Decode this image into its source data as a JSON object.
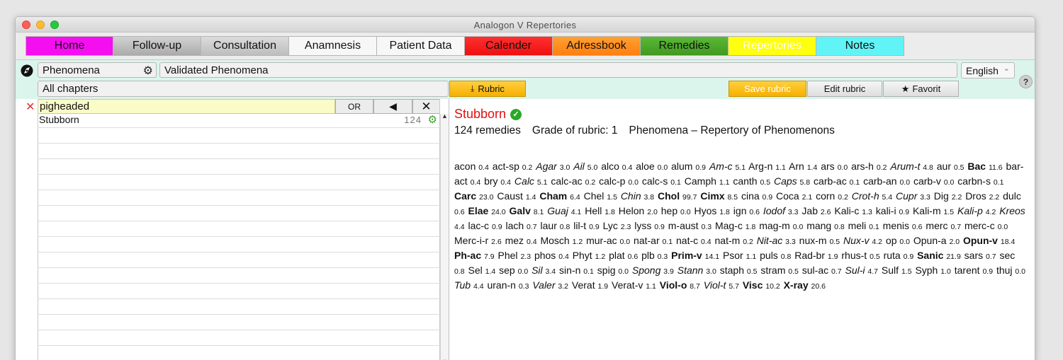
{
  "window": {
    "title": "Analogon  V  Repertories"
  },
  "tabs": [
    {
      "label": "Home",
      "color": "#f40ef0"
    },
    {
      "label": "Follow-up",
      "color": "#b5b5b5"
    },
    {
      "label": "Consultation",
      "color": "#c5c5c5"
    },
    {
      "label": "Anamnesis",
      "color": "#f5f5f5"
    },
    {
      "label": "Patient Data",
      "color": "#f5f5f5"
    },
    {
      "label": "Calender",
      "color": "#ff2020"
    },
    {
      "label": "Adressbook",
      "color": "#ff8a1a"
    },
    {
      "label": "Remedies",
      "color": "#4ea829"
    },
    {
      "label": "Repertories",
      "color": "#ffff10"
    },
    {
      "label": "Notes",
      "color": "#5cf2f4"
    }
  ],
  "toolbar": {
    "repertory_select": "Phenomena",
    "repertory_name": "Validated Phenomena",
    "language": "English",
    "chapter": "All chapters",
    "rubric_button": "Rubric",
    "save_rubric": "Save rubric",
    "edit_rubric": "Edit rubric",
    "favorit": "Favorit",
    "help": "?"
  },
  "search": {
    "value": "pigheaded",
    "or_label": "OR"
  },
  "results": [
    {
      "label": "Stubborn",
      "count": "124"
    }
  ],
  "rubric": {
    "title": "Stubborn",
    "remedies_count": "124 remedies",
    "grade": "Grade of rubric: 1",
    "source": "Phenomena – Repertory of Phenomenons"
  },
  "remedies": [
    {
      "n": "acon",
      "g": "0.4",
      "s": ""
    },
    {
      "n": "act-sp",
      "g": "0.2",
      "s": ""
    },
    {
      "n": "Agar",
      "g": "3.0",
      "s": "i"
    },
    {
      "n": "Ail",
      "g": "5.0",
      "s": "i"
    },
    {
      "n": "alco",
      "g": "0.4",
      "s": ""
    },
    {
      "n": "aloe",
      "g": "0.0",
      "s": ""
    },
    {
      "n": "alum",
      "g": "0.9",
      "s": ""
    },
    {
      "n": "Am-c",
      "g": "5.1",
      "s": "i"
    },
    {
      "n": "Arg-n",
      "g": "1.1",
      "s": ""
    },
    {
      "n": "Arn",
      "g": "1.4",
      "s": ""
    },
    {
      "n": "ars",
      "g": "0.0",
      "s": ""
    },
    {
      "n": "ars-h",
      "g": "0.2",
      "s": ""
    },
    {
      "n": "Arum-t",
      "g": "4.8",
      "s": "i"
    },
    {
      "n": "aur",
      "g": "0.5",
      "s": ""
    },
    {
      "n": "Bac",
      "g": "11.6",
      "s": "b"
    },
    {
      "n": "bar-act",
      "g": "0.4",
      "s": ""
    },
    {
      "n": "bry",
      "g": "0.4",
      "s": ""
    },
    {
      "n": "Calc",
      "g": "5.1",
      "s": "i"
    },
    {
      "n": "calc-ac",
      "g": "0.2",
      "s": ""
    },
    {
      "n": "calc-p",
      "g": "0.0",
      "s": ""
    },
    {
      "n": "calc-s",
      "g": "0.1",
      "s": ""
    },
    {
      "n": "Camph",
      "g": "1.1",
      "s": ""
    },
    {
      "n": "canth",
      "g": "0.5",
      "s": ""
    },
    {
      "n": "Caps",
      "g": "5.8",
      "s": "i"
    },
    {
      "n": "carb-ac",
      "g": "0.1",
      "s": ""
    },
    {
      "n": "carb-an",
      "g": "0.0",
      "s": ""
    },
    {
      "n": "carb-v",
      "g": "0.0",
      "s": ""
    },
    {
      "n": "carbn-s",
      "g": "0.1",
      "s": ""
    },
    {
      "n": "Carc",
      "g": "23.0",
      "s": "b"
    },
    {
      "n": "Caust",
      "g": "1.4",
      "s": ""
    },
    {
      "n": "Cham",
      "g": "6.4",
      "s": "b"
    },
    {
      "n": "Chel",
      "g": "1.5",
      "s": ""
    },
    {
      "n": "Chin",
      "g": "3.8",
      "s": "i"
    },
    {
      "n": "Chol",
      "g": "99.7",
      "s": "b"
    },
    {
      "n": "Cimx",
      "g": "8.5",
      "s": "b"
    },
    {
      "n": "cina",
      "g": "0.9",
      "s": ""
    },
    {
      "n": "Coca",
      "g": "2.1",
      "s": ""
    },
    {
      "n": "corn",
      "g": "0.2",
      "s": ""
    },
    {
      "n": "Crot-h",
      "g": "5.4",
      "s": "i"
    },
    {
      "n": "Cupr",
      "g": "3.3",
      "s": "i"
    },
    {
      "n": "Dig",
      "g": "2.2",
      "s": ""
    },
    {
      "n": "Dros",
      "g": "2.2",
      "s": ""
    },
    {
      "n": "dulc",
      "g": "0.6",
      "s": ""
    },
    {
      "n": "Elae",
      "g": "24.0",
      "s": "b"
    },
    {
      "n": "Galv",
      "g": "8.1",
      "s": "b"
    },
    {
      "n": "Guaj",
      "g": "4.1",
      "s": "i"
    },
    {
      "n": "Hell",
      "g": "1.8",
      "s": ""
    },
    {
      "n": "Helon",
      "g": "2.0",
      "s": ""
    },
    {
      "n": "hep",
      "g": "0.0",
      "s": ""
    },
    {
      "n": "Hyos",
      "g": "1.8",
      "s": ""
    },
    {
      "n": "ign",
      "g": "0.6",
      "s": ""
    },
    {
      "n": "Iodof",
      "g": "3.3",
      "s": "i"
    },
    {
      "n": "Jab",
      "g": "2.6",
      "s": ""
    },
    {
      "n": "Kali-c",
      "g": "1.3",
      "s": ""
    },
    {
      "n": "kali-i",
      "g": "0.9",
      "s": ""
    },
    {
      "n": "Kali-m",
      "g": "1.5",
      "s": ""
    },
    {
      "n": "Kali-p",
      "g": "4.2",
      "s": "i"
    },
    {
      "n": "Kreos",
      "g": "4.4",
      "s": "i"
    },
    {
      "n": "lac-c",
      "g": "0.9",
      "s": ""
    },
    {
      "n": "lach",
      "g": "0.7",
      "s": ""
    },
    {
      "n": "laur",
      "g": "0.8",
      "s": ""
    },
    {
      "n": "lil-t",
      "g": "0.9",
      "s": ""
    },
    {
      "n": "Lyc",
      "g": "2.3",
      "s": ""
    },
    {
      "n": "lyss",
      "g": "0.9",
      "s": ""
    },
    {
      "n": "m-aust",
      "g": "0.3",
      "s": ""
    },
    {
      "n": "Mag-c",
      "g": "1.8",
      "s": ""
    },
    {
      "n": "mag-m",
      "g": "0.0",
      "s": ""
    },
    {
      "n": "mang",
      "g": "0.8",
      "s": ""
    },
    {
      "n": "meli",
      "g": "0.1",
      "s": ""
    },
    {
      "n": "menis",
      "g": "0.6",
      "s": ""
    },
    {
      "n": "merc",
      "g": "0.7",
      "s": ""
    },
    {
      "n": "merc-c",
      "g": "0.0",
      "s": ""
    },
    {
      "n": "Merc-i-r",
      "g": "2.6",
      "s": ""
    },
    {
      "n": "mez",
      "g": "0.4",
      "s": ""
    },
    {
      "n": "Mosch",
      "g": "1.2",
      "s": ""
    },
    {
      "n": "mur-ac",
      "g": "0.0",
      "s": ""
    },
    {
      "n": "nat-ar",
      "g": "0.1",
      "s": ""
    },
    {
      "n": "nat-c",
      "g": "0.4",
      "s": ""
    },
    {
      "n": "nat-m",
      "g": "0.2",
      "s": ""
    },
    {
      "n": "Nit-ac",
      "g": "3.3",
      "s": "i"
    },
    {
      "n": "nux-m",
      "g": "0.5",
      "s": ""
    },
    {
      "n": "Nux-v",
      "g": "4.2",
      "s": "i"
    },
    {
      "n": "op",
      "g": "0.0",
      "s": ""
    },
    {
      "n": "Opun-a",
      "g": "2.0",
      "s": ""
    },
    {
      "n": "Opun-v",
      "g": "18.4",
      "s": "b"
    },
    {
      "n": "Ph-ac",
      "g": "7.9",
      "s": "b"
    },
    {
      "n": "Phel",
      "g": "2.3",
      "s": ""
    },
    {
      "n": "phos",
      "g": "0.4",
      "s": ""
    },
    {
      "n": "Phyt",
      "g": "1.2",
      "s": ""
    },
    {
      "n": "plat",
      "g": "0.6",
      "s": ""
    },
    {
      "n": "plb",
      "g": "0.3",
      "s": ""
    },
    {
      "n": "Prim-v",
      "g": "14.1",
      "s": "b"
    },
    {
      "n": "Psor",
      "g": "1.1",
      "s": ""
    },
    {
      "n": "puls",
      "g": "0.8",
      "s": ""
    },
    {
      "n": "Rad-br",
      "g": "1.9",
      "s": ""
    },
    {
      "n": "rhus-t",
      "g": "0.5",
      "s": ""
    },
    {
      "n": "ruta",
      "g": "0.9",
      "s": ""
    },
    {
      "n": "Sanic",
      "g": "21.9",
      "s": "b"
    },
    {
      "n": "sars",
      "g": "0.7",
      "s": ""
    },
    {
      "n": "sec",
      "g": "0.8",
      "s": ""
    },
    {
      "n": "Sel",
      "g": "1.4",
      "s": ""
    },
    {
      "n": "sep",
      "g": "0.0",
      "s": ""
    },
    {
      "n": "Sil",
      "g": "3.4",
      "s": "i"
    },
    {
      "n": "sin-n",
      "g": "0.1",
      "s": ""
    },
    {
      "n": "spig",
      "g": "0.0",
      "s": ""
    },
    {
      "n": "Spong",
      "g": "3.9",
      "s": "i"
    },
    {
      "n": "Stann",
      "g": "3.0",
      "s": "i"
    },
    {
      "n": "staph",
      "g": "0.5",
      "s": ""
    },
    {
      "n": "stram",
      "g": "0.5",
      "s": ""
    },
    {
      "n": "sul-ac",
      "g": "0.7",
      "s": ""
    },
    {
      "n": "Sul-i",
      "g": "4.7",
      "s": "i"
    },
    {
      "n": "Sulf",
      "g": "1.5",
      "s": ""
    },
    {
      "n": "Syph",
      "g": "1.0",
      "s": ""
    },
    {
      "n": "tarent",
      "g": "0.9",
      "s": ""
    },
    {
      "n": "thuj",
      "g": "0.0",
      "s": ""
    },
    {
      "n": "Tub",
      "g": "4.4",
      "s": "i"
    },
    {
      "n": "uran-n",
      "g": "0.3",
      "s": ""
    },
    {
      "n": "Valer",
      "g": "3.2",
      "s": "i"
    },
    {
      "n": "Verat",
      "g": "1.9",
      "s": ""
    },
    {
      "n": "Verat-v",
      "g": "1.1",
      "s": ""
    },
    {
      "n": "Viol-o",
      "g": "8.7",
      "s": "b"
    },
    {
      "n": "Viol-t",
      "g": "5.7",
      "s": "i"
    },
    {
      "n": "Visc",
      "g": "10.2",
      "s": "b"
    },
    {
      "n": "X-ray",
      "g": "20.6",
      "s": "b"
    }
  ]
}
